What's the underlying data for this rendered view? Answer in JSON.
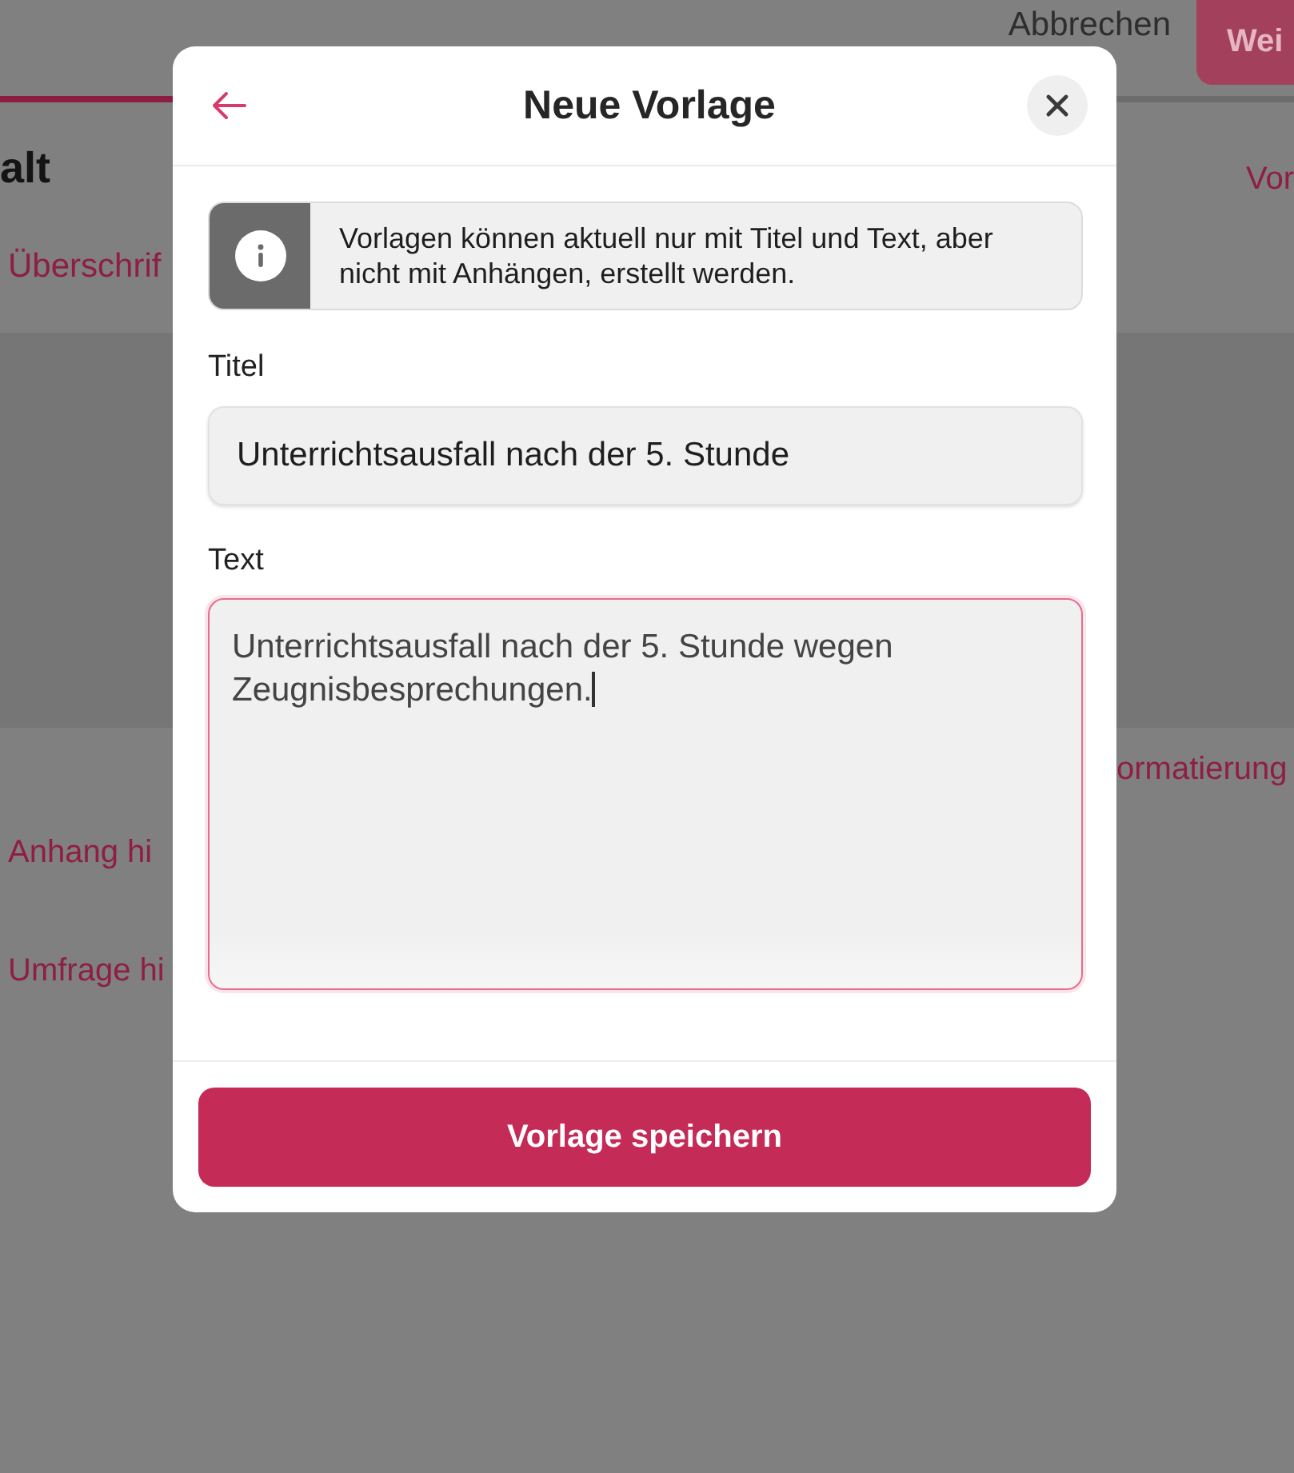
{
  "background_page": {
    "cancel_link": "Abbrechen",
    "next_button": "Wei",
    "heading": "alt",
    "right_link": "Vor",
    "toolbar_link": "Überschrif",
    "format_link": "ormatierung",
    "actions": [
      "Anhang hi",
      "Umfrage hi"
    ]
  },
  "dialog": {
    "title": "Neue Vorlage",
    "info": "Vorlagen können aktuell nur mit Titel und Text, aber nicht mit Anhängen, erstellt werden.",
    "fields": [
      {
        "kind": "input",
        "label": "Titel",
        "value": "Unterrichtsausfall nach der 5. Stunde",
        "focused": false
      },
      {
        "kind": "textarea",
        "label": "Text",
        "value": "Unterrichtsausfall nach der 5. Stunde wegen Zeugnisbesprechungen.",
        "focused": true
      }
    ],
    "save_button": "Vorlage speichern"
  }
}
